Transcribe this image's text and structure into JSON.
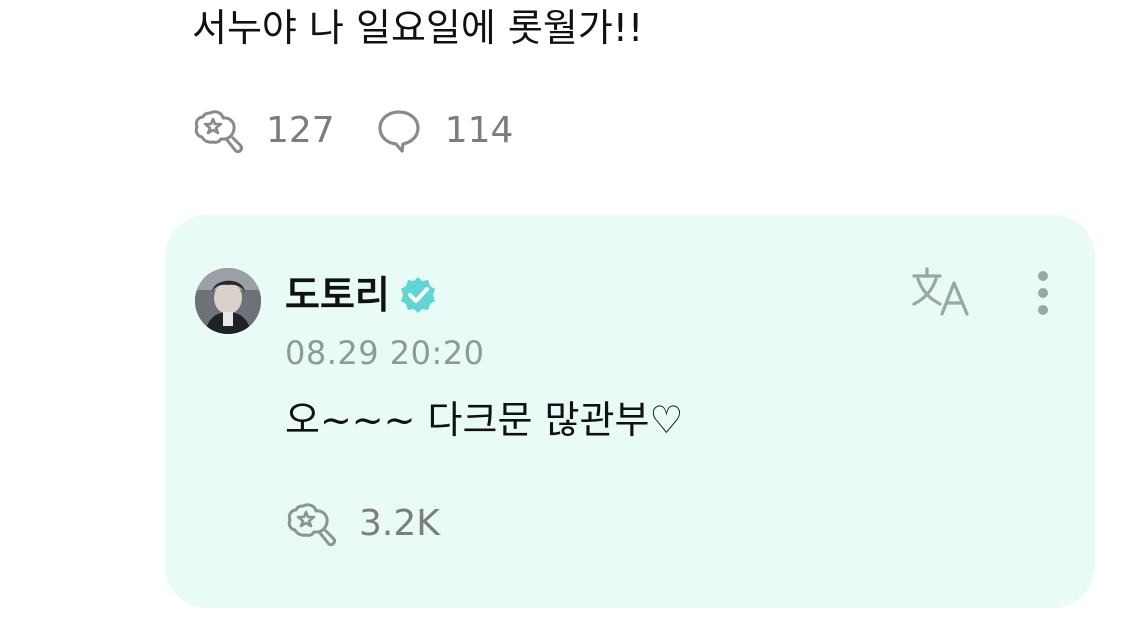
{
  "post": {
    "text": "서누야 나 일요일에 롯월가!!",
    "like_count": "127",
    "comment_count": "114"
  },
  "reply": {
    "author": "도토리",
    "verified": true,
    "timestamp": "08.29 20:20",
    "text": "오~~~ 다크문 많관부♡",
    "like_count": "3.2K"
  },
  "colors": {
    "card_background": "#e9fbf6",
    "verified_badge": "#5fd6d3",
    "muted_text": "#7d7d7d",
    "timestamp_text": "#8f9a97"
  },
  "icons": {
    "like": "like-icon",
    "comment": "comment-icon",
    "verified": "verified-badge-icon",
    "translate": "translate-icon",
    "more": "more-vertical-icon"
  }
}
